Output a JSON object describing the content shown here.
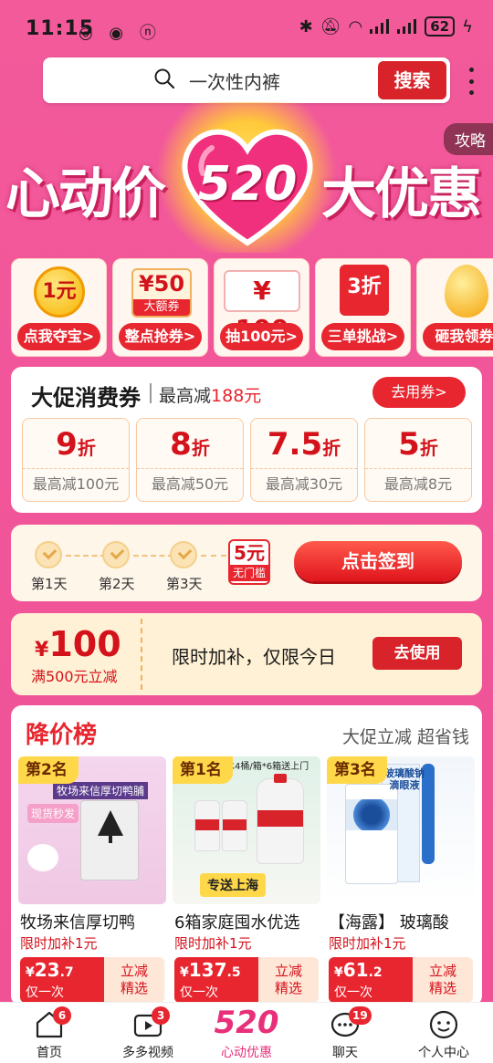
{
  "status_bar": {
    "time": "11:15",
    "battery": "62"
  },
  "search": {
    "placeholder": "一次性内裤",
    "button": "搜索"
  },
  "banner": {
    "left": "心动价",
    "number": "520",
    "right": "大优惠",
    "badge": "攻略"
  },
  "promo_cards": [
    {
      "top": "1元",
      "label": "点我夺宝>"
    },
    {
      "top": "¥50",
      "sub": "大额券",
      "label": "整点抢券>"
    },
    {
      "top": "¥ 100",
      "label": "抽100元>"
    },
    {
      "top": "3折",
      "label": "三单挑战>"
    },
    {
      "label": "砸我领券"
    }
  ],
  "coupons": {
    "title": "大促消费券",
    "subtitle_prefix": "最高减",
    "subtitle_value": "188元",
    "button": "去用券>",
    "items": [
      {
        "discount": "9",
        "unit": "折",
        "limit": "最高减100元"
      },
      {
        "discount": "8",
        "unit": "折",
        "limit": "最高减50元"
      },
      {
        "discount": "7.5",
        "unit": "折",
        "limit": "最高减30元"
      },
      {
        "discount": "5",
        "unit": "折",
        "limit": "最高减8元"
      }
    ]
  },
  "signin": {
    "days": [
      "第1天",
      "第2天",
      "第3天"
    ],
    "reward_value": "5元",
    "reward_sub": "无门槛",
    "button": "点击签到"
  },
  "subsidy": {
    "currency": "¥",
    "amount": "100",
    "condition": "满500元立减",
    "message": "限时加补，仅限今日",
    "button": "去使用"
  },
  "ranking": {
    "title": "降价榜",
    "subtitle": "大促立减 超省钱",
    "products": [
      {
        "rank": "第2名",
        "name": "牧场来信厚切鸭",
        "tag": "限时加补1元",
        "price_symbol": "¥",
        "price_int": "23",
        "price_dec": ".7",
        "price_note": "仅一次",
        "cut1": "立减",
        "cut2": "精选",
        "img_text": "牧场来信厚切鸭脯",
        "img_note": "现货秒发"
      },
      {
        "rank": "第1名",
        "name": "6箱家庭囤水优选",
        "tag": "限时加补1元",
        "price_symbol": "¥",
        "price_int": "137",
        "price_dec": ".5",
        "price_note": "仅一次",
        "cut1": "立减",
        "cut2": "精选",
        "img_text": "净水4桶/箱*6箱送上门",
        "img_note": "专送上海"
      },
      {
        "rank": "第3名",
        "name": "【海露】 玻璃酸",
        "tag": "限时加补1元",
        "price_symbol": "¥",
        "price_int": "61",
        "price_dec": ".2",
        "price_note": "仅一次",
        "cut1": "立减",
        "cut2": "精选",
        "img_text": "玻璃酸钠滴眼液",
        "img_note": ""
      }
    ]
  },
  "tabs": [
    {
      "label": "首页",
      "badge": "6"
    },
    {
      "label": "多多视频",
      "badge": "3"
    },
    {
      "label": "心动优惠",
      "big": "520"
    },
    {
      "label": "聊天",
      "badge": "19"
    },
    {
      "label": "个人中心"
    }
  ],
  "colors": {
    "accent": "#e8262f",
    "background": "#f2569a",
    "brand_520": "#e8307a"
  }
}
